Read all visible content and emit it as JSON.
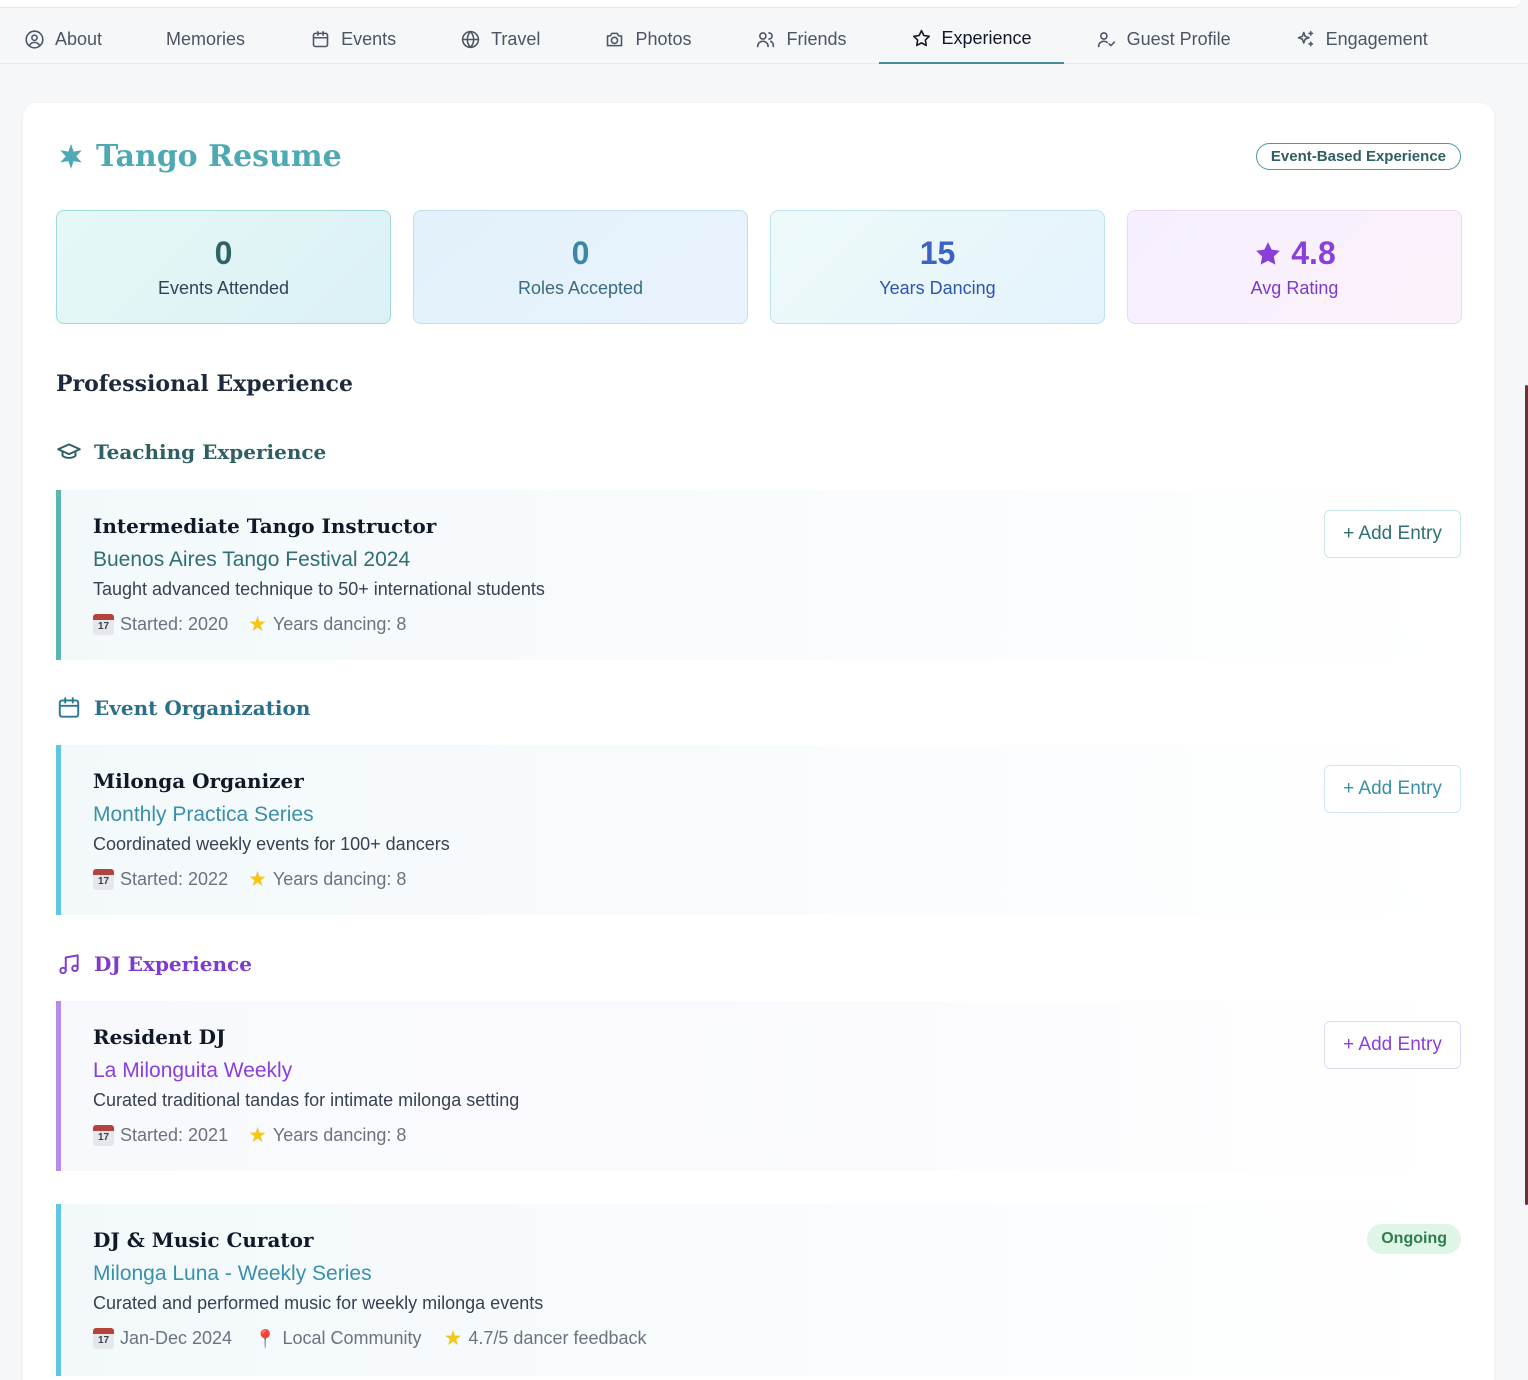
{
  "tabs": [
    {
      "label": "About",
      "icon": "user-circle-icon"
    },
    {
      "label": "Memories",
      "icon": ""
    },
    {
      "label": "Events",
      "icon": "calendar-icon"
    },
    {
      "label": "Travel",
      "icon": "globe-icon"
    },
    {
      "label": "Photos",
      "icon": "camera-icon"
    },
    {
      "label": "Friends",
      "icon": "users-icon"
    },
    {
      "label": "Experience",
      "icon": "star-icon",
      "active": true
    },
    {
      "label": "Guest Profile",
      "icon": "user-check-icon"
    },
    {
      "label": "Engagement",
      "icon": "sparkles-icon"
    }
  ],
  "page": {
    "title": "Tango Resume",
    "badge": "Event-Based Experience",
    "accent": "#4fa9b5"
  },
  "stats": [
    {
      "value": "0",
      "label": "Events Attended"
    },
    {
      "value": "0",
      "label": "Roles Accepted"
    },
    {
      "value": "15",
      "label": "Years Dancing"
    },
    {
      "value": "4.8",
      "label": "Avg Rating"
    }
  ],
  "section_title": "Professional Experience",
  "groups": {
    "teaching": {
      "title": "Teaching Experience",
      "color": "#2f5f63",
      "entry": {
        "role": "Intermediate Tango Instructor",
        "org": "Buenos Aires Tango Festival 2024",
        "desc": "Taught advanced technique to 50+ international students",
        "started": "Started: 2020",
        "years": "Years dancing: 8",
        "button": "+ Add Entry"
      }
    },
    "organization": {
      "title": "Event Organization",
      "color": "#2b6f8a",
      "entry": {
        "role": "Milonga Organizer",
        "org": "Monthly Practica Series",
        "desc": "Coordinated weekly events for 100+ dancers",
        "started": "Started: 2022",
        "years": "Years dancing: 8",
        "button": "+ Add Entry"
      }
    },
    "dj": {
      "title": "DJ Experience",
      "color": "#7e3bcf",
      "entry": {
        "role": "Resident DJ",
        "org": "La Milonguita Weekly",
        "desc": "Curated traditional tandas for intimate milonga setting",
        "started": "Started: 2021",
        "years": "Years dancing: 8",
        "button": "+ Add Entry"
      },
      "entry2": {
        "role": "DJ & Music Curator",
        "org": "Milonga Luna - Weekly Series",
        "desc": "Curated and performed music for weekly milonga events",
        "dates": "Jan-Dec 2024",
        "location": "Local Community",
        "feedback": "4.7/5 dancer feedback",
        "status": "Ongoing"
      }
    }
  },
  "calendar_glyph": "17"
}
